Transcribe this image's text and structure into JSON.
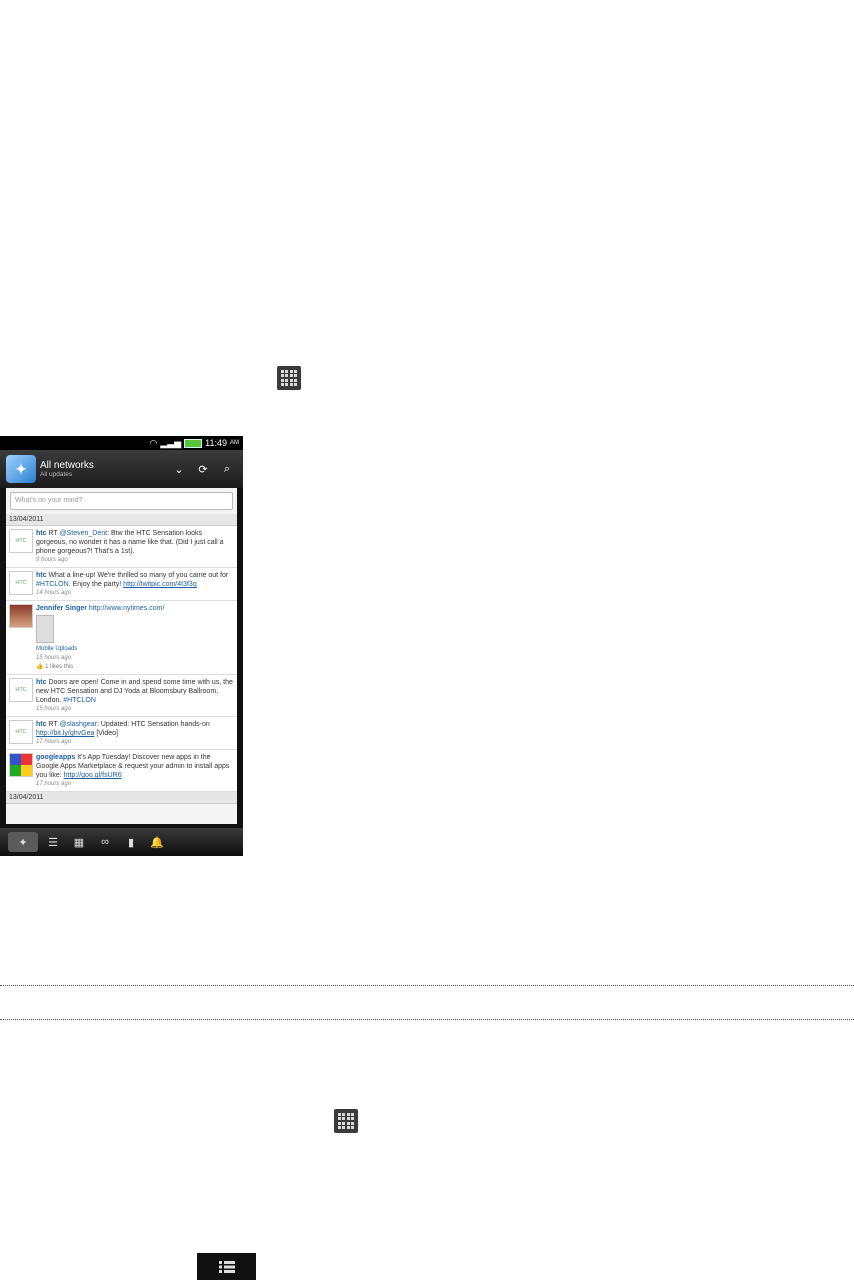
{
  "icons": {
    "all_apps_1": "all-apps-grid-icon",
    "all_apps_2": "all-apps-grid-icon",
    "menu": "menu-list-icon"
  },
  "phone": {
    "status": {
      "time": "11:49",
      "ampm": "AM"
    },
    "header": {
      "title": "All networks",
      "subtitle": "All updates"
    },
    "composer_placeholder": "What's on your mind?",
    "date_header_1": "13/04/2011",
    "date_header_2": "13/04/2011",
    "feed": [
      {
        "user": "htc",
        "rt": "RT",
        "mention": "@Steven_Dent",
        "text": ": Btw the HTC Sensation looks gorgeous, no wonder it has a name like that. (Did I just call a phone gorgeous?! That's a 1st).",
        "time": "9 hours ago"
      },
      {
        "user": "htc",
        "text": "What a line-up! We're thrilled so many of you came out for ",
        "hashtag": "#HTCLON",
        "text2": ". Enjoy the party! ",
        "link": "http://twitpic.com/4t3f3q",
        "time": "14 hours ago"
      },
      {
        "user": "Jennifer Singer",
        "link": "http://www.nytimes.com/",
        "album": "Mobile Uploads",
        "time": "15 hours ago",
        "likes": "1 likes this"
      },
      {
        "user": "htc",
        "text": "Doors are open! Come in and spend some time with us, the new HTC Sensation and DJ Yoda at Bloomsbury Ballroom, London. ",
        "hashtag": "#HTCLON",
        "time": "15 hours ago"
      },
      {
        "user": "htc",
        "rt": "RT",
        "mention": "@slashgear",
        "text": ": Updated: HTC Sensation hands-on ",
        "link": "http://bit.ly/ghvGea",
        "text2": " [Video]",
        "time": "17 hours ago"
      },
      {
        "user": "googleapps",
        "text": "It's App Tuesday! Discover new apps in the Google Apps Marketplace & request your admin to install apps you like: ",
        "link": "http://goo.gl/fsUR6",
        "time": "17 hours ago"
      }
    ]
  }
}
